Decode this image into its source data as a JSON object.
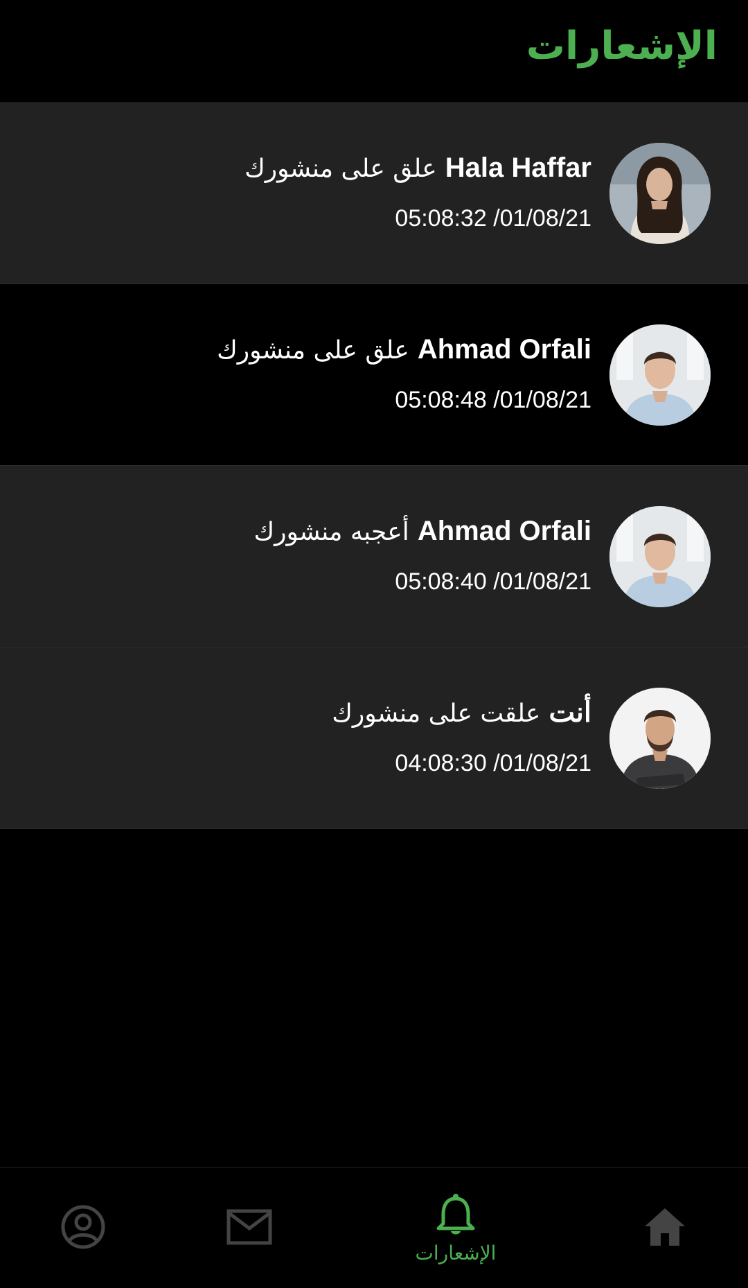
{
  "header": {
    "title": "الإشعارات"
  },
  "notifications": [
    {
      "name": "Hala Haffar",
      "action": "علق على منشورك",
      "time": "05:08:32 /01/08/21",
      "avatar": "woman-portrait"
    },
    {
      "name": "Ahmad Orfali",
      "action": "علق على منشورك",
      "time": "05:08:48 /01/08/21",
      "avatar": "man-portrait-light-shirt"
    },
    {
      "name": "Ahmad Orfali",
      "action": "أعجبه منشورك",
      "time": "05:08:40 /01/08/21",
      "avatar": "man-portrait-light-shirt"
    },
    {
      "name": "أنت",
      "action": "علقت على منشورك",
      "time": "04:08:30 /01/08/21",
      "avatar": "man-portrait-dark-shirt"
    }
  ],
  "bottom_nav": {
    "items": [
      {
        "icon": "profile-icon",
        "label": ""
      },
      {
        "icon": "mail-icon",
        "label": ""
      },
      {
        "icon": "bell-icon",
        "label": "الإشعارات",
        "active": true
      },
      {
        "icon": "home-icon",
        "label": ""
      }
    ]
  },
  "colors": {
    "accent": "#4caf50",
    "background": "#000000",
    "row_alt": "#222222",
    "icon_inactive": "#444444"
  }
}
